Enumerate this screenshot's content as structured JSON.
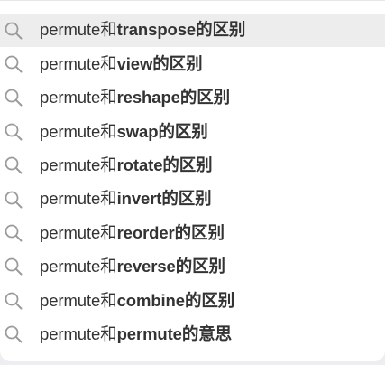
{
  "suggestions": [
    {
      "prefix": "permute和",
      "highlight": "transpose的区别",
      "icon": "search-icon",
      "active": true
    },
    {
      "prefix": "permute和",
      "highlight": "view的区别",
      "icon": "search-icon",
      "active": false
    },
    {
      "prefix": "permute和",
      "highlight": "reshape的区别",
      "icon": "search-icon",
      "active": false
    },
    {
      "prefix": "permute和",
      "highlight": "swap的区别",
      "icon": "search-icon",
      "active": false
    },
    {
      "prefix": "permute和",
      "highlight": "rotate的区别",
      "icon": "search-icon",
      "active": false
    },
    {
      "prefix": "permute和",
      "highlight": "invert的区别",
      "icon": "search-icon",
      "active": false
    },
    {
      "prefix": "permute和",
      "highlight": "reorder的区别",
      "icon": "search-icon",
      "active": false
    },
    {
      "prefix": "permute和",
      "highlight": "reverse的区别",
      "icon": "search-icon",
      "active": false
    },
    {
      "prefix": "permute和",
      "highlight": "combine的区别",
      "icon": "search-icon",
      "active": false
    },
    {
      "prefix": "permute和",
      "highlight": "permute的意思",
      "icon": "search-icon",
      "active": false
    }
  ],
  "colors": {
    "icon": "#9a9a9a",
    "text": "#333333",
    "active_row": "#ededed"
  }
}
